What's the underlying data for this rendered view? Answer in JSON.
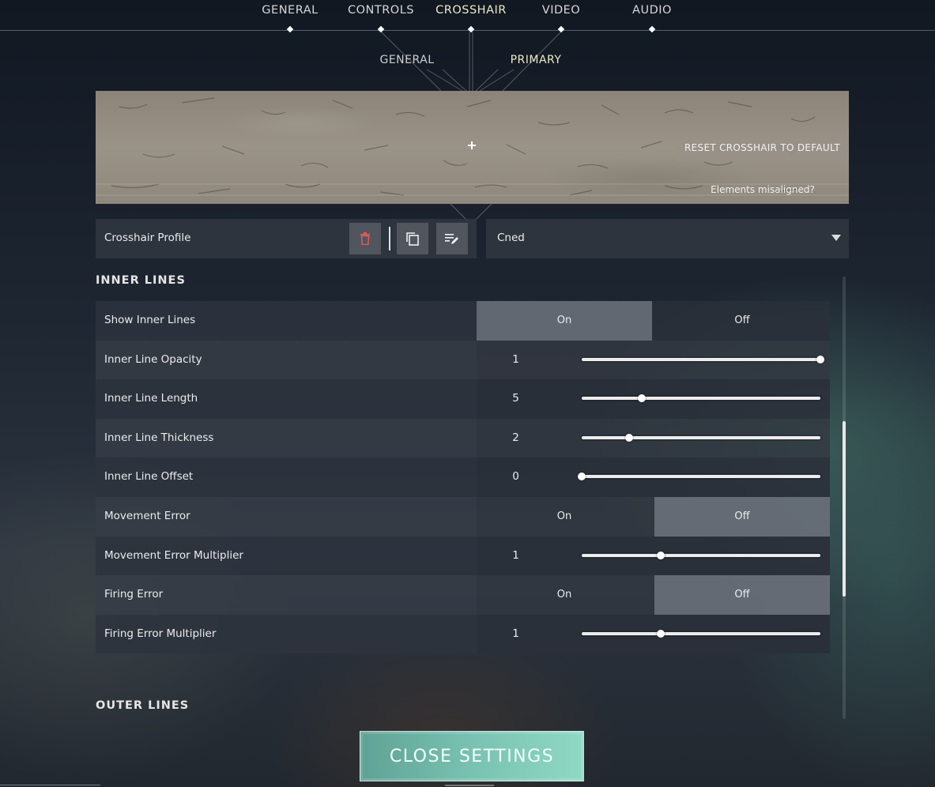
{
  "nav": {
    "tabs": [
      {
        "label": "GENERAL",
        "active": false
      },
      {
        "label": "CONTROLS",
        "active": false
      },
      {
        "label": "CROSSHAIR",
        "active": true
      },
      {
        "label": "VIDEO",
        "active": false
      },
      {
        "label": "AUDIO",
        "active": false
      }
    ],
    "subtabs": [
      {
        "label": "GENERAL",
        "active": false
      },
      {
        "label": "PRIMARY",
        "active": true
      }
    ]
  },
  "preview": {
    "reset_label": "RESET CROSSHAIR TO DEFAULT",
    "misaligned_link": "Elements misaligned?"
  },
  "profile": {
    "label": "Crosshair Profile",
    "delete_icon": "trash-icon",
    "copy_icon": "copy-icon",
    "rename_icon": "edit-list-icon",
    "selected": "Cned"
  },
  "inner_lines": {
    "title": "INNER LINES",
    "rows": [
      {
        "label": "Show Inner Lines",
        "type": "toggle",
        "on": "On",
        "off": "Off",
        "selected": "on"
      },
      {
        "label": "Inner Line Opacity",
        "type": "slider",
        "value": "1",
        "fraction": 1.0
      },
      {
        "label": "Inner Line Length",
        "type": "slider",
        "value": "5",
        "fraction": 0.25
      },
      {
        "label": "Inner Line Thickness",
        "type": "slider",
        "value": "2",
        "fraction": 0.2
      },
      {
        "label": "Inner Line Offset",
        "type": "slider",
        "value": "0",
        "fraction": 0.0
      },
      {
        "label": "Movement Error",
        "type": "toggle",
        "on": "On",
        "off": "Off",
        "selected": "off"
      },
      {
        "label": "Movement Error Multiplier",
        "type": "slider",
        "value": "1",
        "fraction": 0.33
      },
      {
        "label": "Firing Error",
        "type": "toggle",
        "on": "On",
        "off": "Off",
        "selected": "off"
      },
      {
        "label": "Firing Error Multiplier",
        "type": "slider",
        "value": "1",
        "fraction": 0.33
      }
    ]
  },
  "outer_lines": {
    "title": "OUTER LINES"
  },
  "close_label": "CLOSE SETTINGS",
  "colors": {
    "accent": "#79c2b1",
    "active_tab": "#ece8c8"
  }
}
